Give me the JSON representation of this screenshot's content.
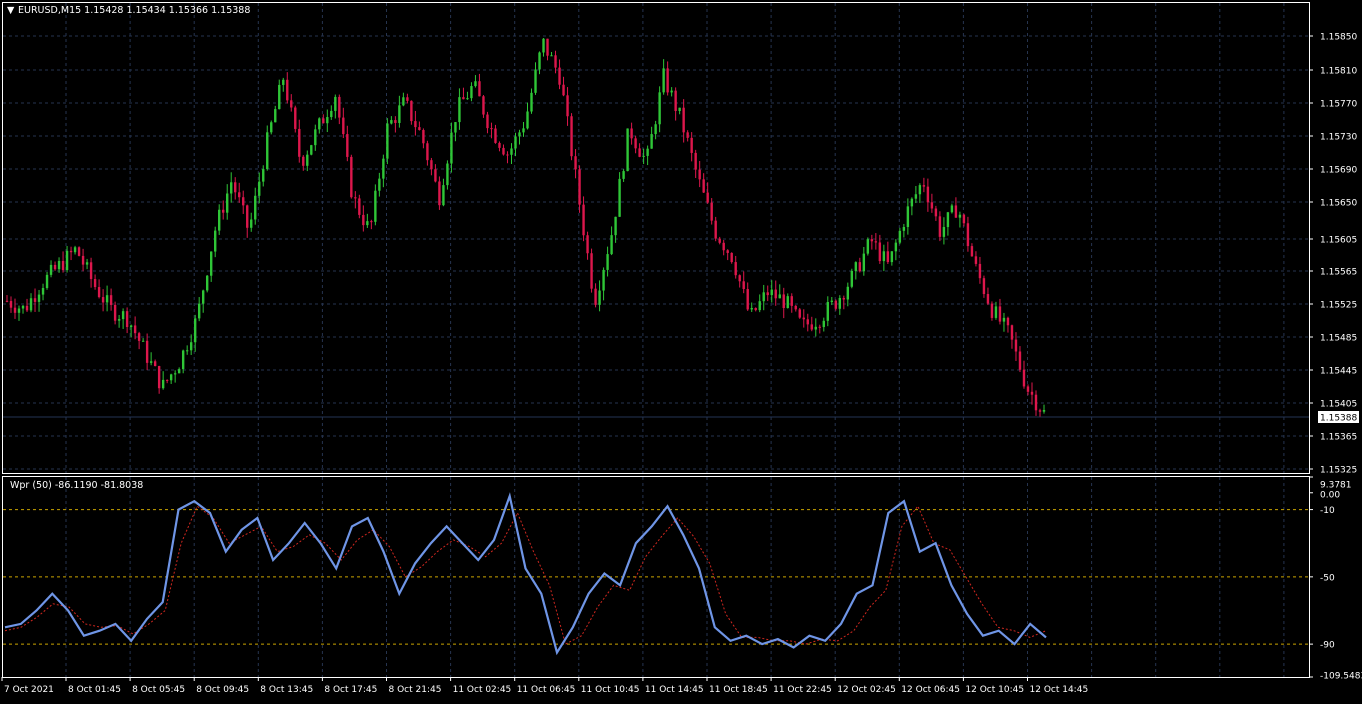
{
  "colors": {
    "background": "#000000",
    "grid": "#26344f",
    "frame": "#ffffff",
    "bull": "#2fc637",
    "bear": "#dd174c",
    "wpr_line": "#6f95e6",
    "wpr_signal": "#d0271f",
    "level_line": "#c9a400",
    "bid_line": "#243454",
    "text": "#ffffff"
  },
  "main_chart": {
    "header_arrow": "▼",
    "header_text": "EURUSD,M15  1.15428 1.15434 1.15366 1.15388",
    "current_price": "1.15388",
    "price_labels": [
      "1.15850",
      "1.15810",
      "1.15770",
      "1.15730",
      "1.15690",
      "1.15650",
      "1.15605",
      "1.15565",
      "1.15525",
      "1.15485",
      "1.15445",
      "1.15405",
      "1.15365",
      "1.15325"
    ]
  },
  "indicator": {
    "header_text": "Wpr (50) -86.1190 -81.8038",
    "scale_labels": [
      "9.3781",
      "0.00",
      "-10",
      "-50",
      "-90",
      "-109.5483"
    ],
    "levels": [
      -10,
      -50,
      -90
    ]
  },
  "time_labels": [
    "7 Oct 2021",
    "8 Oct 01:45",
    "8 Oct 05:45",
    "8 Oct 09:45",
    "8 Oct 13:45",
    "8 Oct 17:45",
    "8 Oct 21:45",
    "11 Oct 02:45",
    "11 Oct 06:45",
    "11 Oct 10:45",
    "11 Oct 14:45",
    "11 Oct 18:45",
    "11 Oct 22:45",
    "12 Oct 02:45",
    "12 Oct 06:45",
    "12 Oct 10:45",
    "12 Oct 14:45"
  ],
  "chart_data": [
    {
      "type": "candlestick",
      "title": "EURUSD,M15",
      "timeframe": "M15",
      "ohlc_last": {
        "open": 1.15428,
        "high": 1.15434,
        "low": 1.15366,
        "close": 1.15388
      },
      "ylim": [
        1.15325,
        1.1587
      ],
      "x_ticks": [
        "7 Oct 2021",
        "8 Oct 01:45",
        "8 Oct 05:45",
        "8 Oct 09:45",
        "8 Oct 13:45",
        "8 Oct 17:45",
        "8 Oct 21:45",
        "11 Oct 02:45",
        "11 Oct 06:45",
        "11 Oct 10:45",
        "11 Oct 14:45",
        "11 Oct 18:45",
        "11 Oct 22:45",
        "12 Oct 02:45",
        "12 Oct 06:45",
        "12 Oct 10:45",
        "12 Oct 14:45"
      ],
      "close_path": [
        1.1552,
        1.1551,
        1.1554,
        1.1556,
        1.1558,
        1.1554,
        1.1551,
        1.155,
        1.1546,
        1.1542,
        1.1545,
        1.155,
        1.156,
        1.1566,
        1.156,
        1.157,
        1.1578,
        1.1568,
        1.1572,
        1.1576,
        1.1564,
        1.156,
        1.1572,
        1.1575,
        1.1571,
        1.1564,
        1.1574,
        1.1577,
        1.1572,
        1.1569,
        1.1573,
        1.1582,
        1.1578,
        1.1565,
        1.1552,
        1.156,
        1.1572,
        1.1568,
        1.1578,
        1.1573,
        1.1566,
        1.156,
        1.1557,
        1.155,
        1.1553,
        1.1552,
        1.1549,
        1.155,
        1.1552,
        1.1555,
        1.1559,
        1.1556,
        1.1562,
        1.1566,
        1.156,
        1.1563,
        1.1556,
        1.1551,
        1.1548,
        1.1542,
        1.1539
      ],
      "grid": true
    },
    {
      "type": "line",
      "title": "Wpr (50) -86.1190 -81.8038",
      "ylim": [
        -109.5483,
        9.3781
      ],
      "levels": [
        -10,
        -50,
        -90
      ],
      "series": [
        {
          "name": "Wpr (50)",
          "values": [
            -80,
            -78,
            -70,
            -60,
            -70,
            -85,
            -82,
            -78,
            -88,
            -75,
            -65,
            -10,
            -5,
            -12,
            -35,
            -22,
            -15,
            -40,
            -30,
            -18,
            -30,
            -45,
            -20,
            -15,
            -35,
            -60,
            -42,
            -30,
            -20,
            -30,
            -40,
            -28,
            -2,
            -45,
            -60,
            -95,
            -80,
            -60,
            -48,
            -55,
            -30,
            -20,
            -8,
            -25,
            -45,
            -80,
            -88,
            -85,
            -90,
            -87,
            -92,
            -85,
            -88,
            -78,
            -60,
            -55,
            -12,
            -5,
            -35,
            -30,
            -55,
            -72,
            -85,
            -82,
            -90,
            -78,
            -86
          ]
        },
        {
          "name": "signal",
          "values": [
            -82,
            -80,
            -74,
            -66,
            -68,
            -78,
            -80,
            -79,
            -84,
            -78,
            -70,
            -30,
            -8,
            -15,
            -30,
            -25,
            -20,
            -35,
            -32,
            -25,
            -30,
            -40,
            -28,
            -22,
            -32,
            -50,
            -44,
            -35,
            -28,
            -32,
            -38,
            -30,
            -12,
            -35,
            -55,
            -90,
            -85,
            -68,
            -55,
            -58,
            -38,
            -26,
            -15,
            -26,
            -42,
            -72,
            -86,
            -86,
            -88,
            -88,
            -90,
            -87,
            -88,
            -82,
            -68,
            -58,
            -20,
            -8,
            -30,
            -34,
            -50,
            -66,
            -80,
            -82,
            -86,
            -82
          ]
        }
      ],
      "x_ticks": [
        "7 Oct 2021",
        "8 Oct 01:45",
        "8 Oct 05:45",
        "8 Oct 09:45",
        "8 Oct 13:45",
        "8 Oct 17:45",
        "8 Oct 21:45",
        "11 Oct 02:45",
        "11 Oct 06:45",
        "11 Oct 10:45",
        "11 Oct 14:45",
        "11 Oct 18:45",
        "11 Oct 22:45",
        "12 Oct 02:45",
        "12 Oct 06:45",
        "12 Oct 10:45",
        "12 Oct 14:45"
      ],
      "grid": true
    }
  ]
}
